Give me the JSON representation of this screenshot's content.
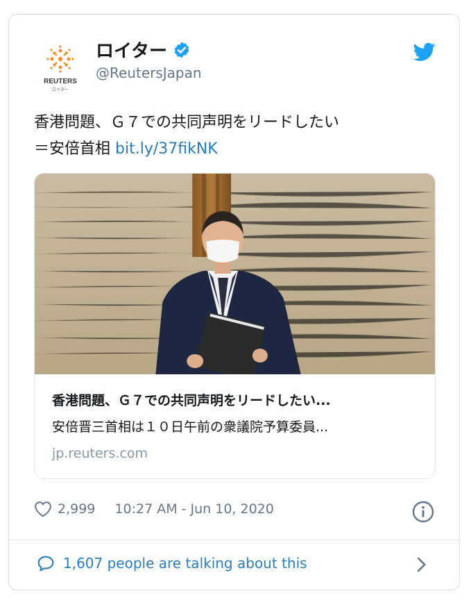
{
  "author": {
    "logo_text": "REUTERS",
    "logo_sub": "ロイター",
    "name": "ロイター",
    "handle": "@ReutersJapan"
  },
  "tweet": {
    "text_line1": "香港問題、Ｇ７での共同声明をリードしたい",
    "text_line2": "＝安倍首相",
    "link": "bit.ly/37fikNK"
  },
  "embed": {
    "title": "香港問題、Ｇ７での共同声明をリードしたい...",
    "description": "安倍晋三首相は１０日午前の衆議院予算委員...",
    "domain": "jp.reuters.com"
  },
  "meta": {
    "likes": "2,999",
    "timestamp": "10:27 AM - Jun 10, 2020"
  },
  "footer": {
    "talking": "1,607 people are talking about this"
  },
  "colors": {
    "accent": "#1da1f2",
    "link": "#2b7bb9",
    "muted": "#657786",
    "border": "#e1e8ed",
    "reuters_orange": "#f08c1e"
  },
  "icons": [
    "reuters-logo-icon",
    "verified-badge-icon",
    "twitter-bird-icon",
    "heart-icon",
    "info-icon",
    "speech-bubble-icon",
    "chevron-right-icon"
  ]
}
